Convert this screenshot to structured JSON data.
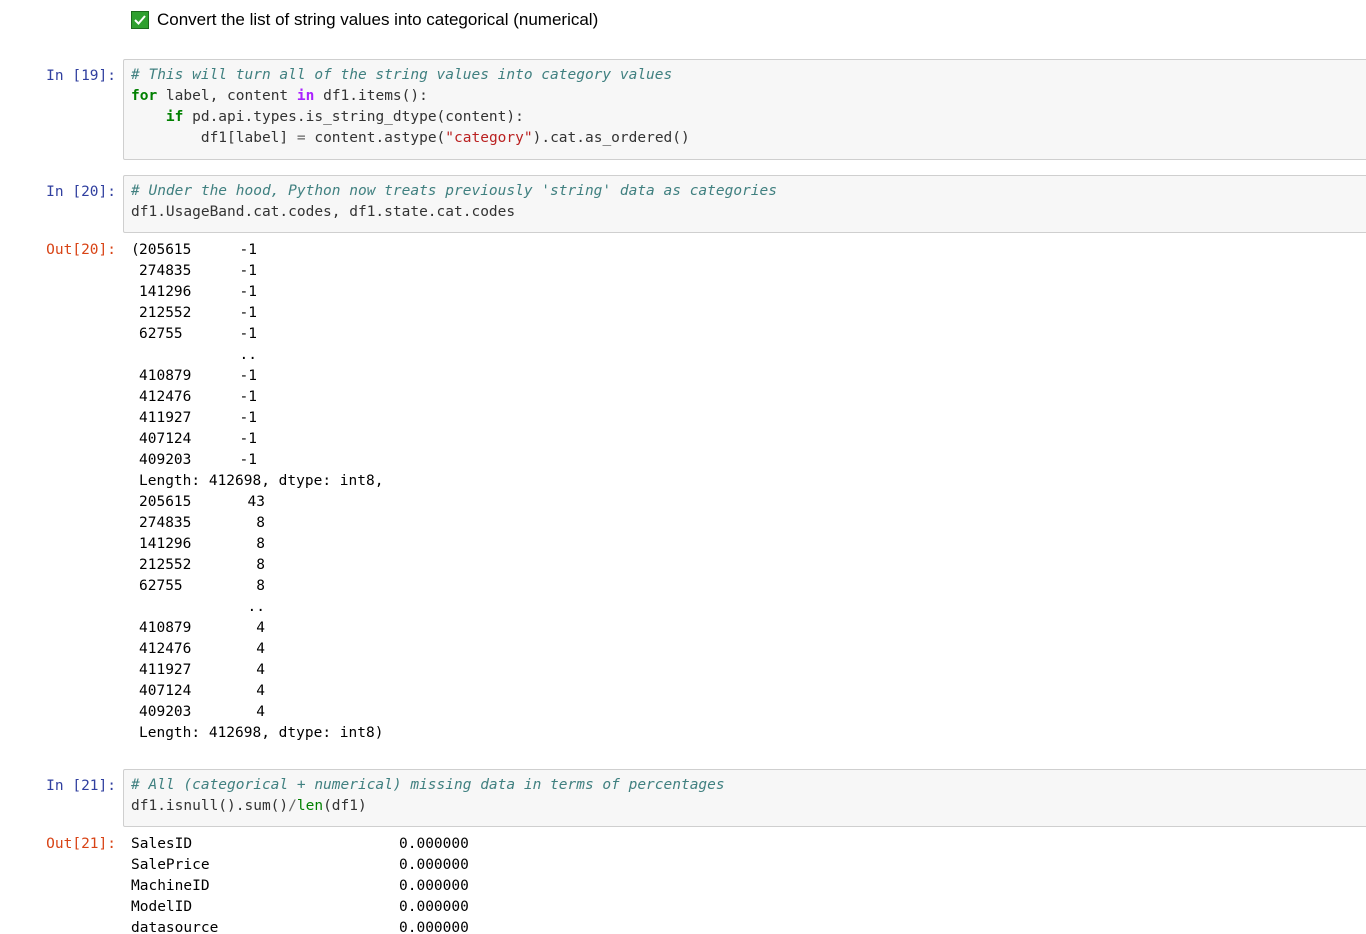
{
  "markdown": {
    "checkbox_checked": true,
    "text": "Convert the list of string values into categorical (numerical)"
  },
  "cell19": {
    "prompt": "In [19]:",
    "line1_comment": "# This will turn all of the string values into category values",
    "line2_for": "for",
    "line2_mid": " label, content ",
    "line2_in": "in",
    "line2_end": " df1.items():",
    "line3_indent": "    ",
    "line3_if": "if",
    "line3_rest": " pd.api.types.is_string_dtype(content):",
    "line4_start": "        df1[label] ",
    "line4_eq": "=",
    "line4_mid": " content.astype(",
    "line4_str": "\"category\"",
    "line4_end": ").cat.as_ordered()"
  },
  "cell20": {
    "prompt": "In [20]:",
    "line1_comment": "# Under the hood, Python now treats previously 'string' data as categories",
    "line2": "df1.UsageBand.cat.codes, df1.state.cat.codes",
    "out_prompt": "Out[20]:",
    "open_paren": "(",
    "series1": [
      {
        "idx": "205615",
        "val": "-1"
      },
      {
        "idx": "274835",
        "val": "-1"
      },
      {
        "idx": "141296",
        "val": "-1"
      },
      {
        "idx": "212552",
        "val": "-1"
      },
      {
        "idx": "62755",
        "val": "-1"
      },
      {
        "idx": "",
        "val": ".."
      },
      {
        "idx": "410879",
        "val": "-1"
      },
      {
        "idx": "412476",
        "val": "-1"
      },
      {
        "idx": "411927",
        "val": "-1"
      },
      {
        "idx": "407124",
        "val": "-1"
      },
      {
        "idx": "409203",
        "val": "-1"
      }
    ],
    "length1": "Length: 412698, dtype: int8,",
    "series2": [
      {
        "idx": "205615",
        "val": "43"
      },
      {
        "idx": "274835",
        "val": "8"
      },
      {
        "idx": "141296",
        "val": "8"
      },
      {
        "idx": "212552",
        "val": "8"
      },
      {
        "idx": "62755",
        "val": "8"
      },
      {
        "idx": "",
        "val": ".."
      },
      {
        "idx": "410879",
        "val": "4"
      },
      {
        "idx": "412476",
        "val": "4"
      },
      {
        "idx": "411927",
        "val": "4"
      },
      {
        "idx": "407124",
        "val": "4"
      },
      {
        "idx": "409203",
        "val": "4"
      }
    ],
    "length2": "Length: 412698, dtype: int8)"
  },
  "cell21": {
    "prompt": "In [21]:",
    "line1_comment": "# All (categorical + numerical) missing data in terms of percentages",
    "line2_a": "df1.isnull().sum()",
    "line2_op": "/",
    "line2_len": "len",
    "line2_b": "(df1)",
    "out_prompt": "Out[21]:",
    "rows": [
      {
        "name": "SalesID",
        "val": "0.000000"
      },
      {
        "name": "SalePrice",
        "val": "0.000000"
      },
      {
        "name": "MachineID",
        "val": "0.000000"
      },
      {
        "name": "ModelID",
        "val": "0.000000"
      },
      {
        "name": "datasource",
        "val": "0.000000"
      }
    ]
  }
}
